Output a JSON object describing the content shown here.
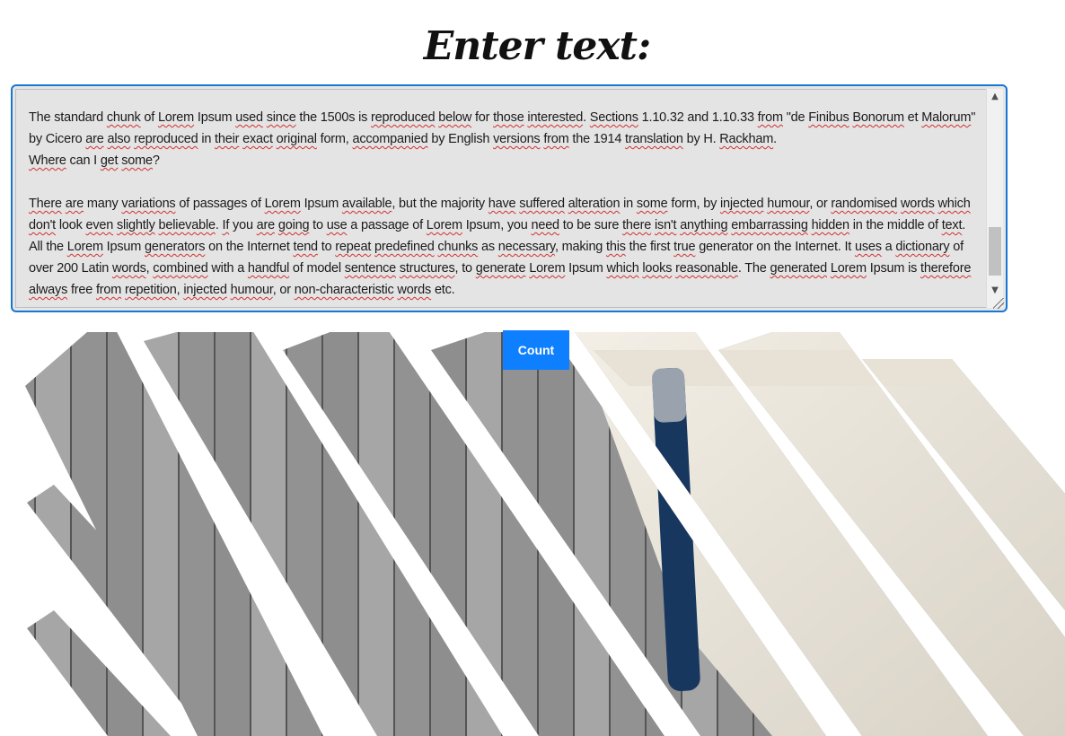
{
  "heading": "Enter text:",
  "textarea": {
    "segments": [
      [
        "The standard ",
        0
      ],
      [
        "chunk",
        1
      ],
      [
        " of ",
        0
      ],
      [
        "Lorem",
        1
      ],
      [
        " Ipsum ",
        0
      ],
      [
        "used",
        1
      ],
      [
        " ",
        0
      ],
      [
        "since",
        1
      ],
      [
        " the 1500s is ",
        0
      ],
      [
        "reproduced",
        1
      ],
      [
        " ",
        0
      ],
      [
        "below",
        1
      ],
      [
        " for ",
        0
      ],
      [
        "those",
        1
      ],
      [
        " ",
        0
      ],
      [
        "interested",
        1
      ],
      [
        ". ",
        0
      ],
      [
        "Sections",
        1
      ],
      [
        " 1.10.32 and 1.10.33 ",
        0
      ],
      [
        "from",
        1
      ],
      [
        " \"de ",
        0
      ],
      [
        "Finibus",
        1
      ],
      [
        " ",
        0
      ],
      [
        "Bonorum",
        1
      ],
      [
        " et ",
        0
      ],
      [
        "Malorum",
        1
      ],
      [
        "\" by Cicero ",
        0
      ],
      [
        "are",
        1
      ],
      [
        " ",
        0
      ],
      [
        "also",
        1
      ],
      [
        " ",
        0
      ],
      [
        "reproduced",
        1
      ],
      [
        " in ",
        0
      ],
      [
        "their",
        1
      ],
      [
        " ",
        0
      ],
      [
        "exact",
        1
      ],
      [
        " ",
        0
      ],
      [
        "original",
        1
      ],
      [
        " form, ",
        0
      ],
      [
        "accompanied",
        1
      ],
      [
        " by English ",
        0
      ],
      [
        "versions",
        1
      ],
      [
        " ",
        0
      ],
      [
        "from",
        1
      ],
      [
        " the 1914 ",
        0
      ],
      [
        "translation",
        1
      ],
      [
        " by H. ",
        0
      ],
      [
        "Rackham",
        1
      ],
      [
        ".\n",
        0
      ],
      [
        "Where",
        1
      ],
      [
        " can I ",
        0
      ],
      [
        "get",
        1
      ],
      [
        " ",
        0
      ],
      [
        "some",
        1
      ],
      [
        "?\n\n",
        0
      ],
      [
        "There",
        1
      ],
      [
        " ",
        0
      ],
      [
        "are",
        1
      ],
      [
        " many ",
        0
      ],
      [
        "variations",
        1
      ],
      [
        " of passages of ",
        0
      ],
      [
        "Lorem",
        1
      ],
      [
        " Ipsum ",
        0
      ],
      [
        "available",
        1
      ],
      [
        ", but the majority ",
        0
      ],
      [
        "have",
        1
      ],
      [
        " ",
        0
      ],
      [
        "suffered",
        1
      ],
      [
        " ",
        0
      ],
      [
        "alteration",
        1
      ],
      [
        " in ",
        0
      ],
      [
        "some",
        1
      ],
      [
        " form, by ",
        0
      ],
      [
        "injected",
        1
      ],
      [
        " ",
        0
      ],
      [
        "humour",
        1
      ],
      [
        ", or ",
        0
      ],
      [
        "randomised",
        1
      ],
      [
        " ",
        0
      ],
      [
        "words",
        1
      ],
      [
        " ",
        0
      ],
      [
        "which",
        1
      ],
      [
        " ",
        0
      ],
      [
        "don't",
        1
      ],
      [
        " look ",
        0
      ],
      [
        "even",
        1
      ],
      [
        " ",
        0
      ],
      [
        "slightly",
        1
      ],
      [
        " ",
        0
      ],
      [
        "believable",
        1
      ],
      [
        ". ",
        0
      ],
      [
        "If",
        1
      ],
      [
        " you ",
        0
      ],
      [
        "are",
        1
      ],
      [
        " ",
        0
      ],
      [
        "going",
        1
      ],
      [
        " to ",
        0
      ],
      [
        "use",
        1
      ],
      [
        " a passage of ",
        0
      ],
      [
        "Lorem",
        1
      ],
      [
        " Ipsum, you ",
        0
      ],
      [
        "need",
        1
      ],
      [
        " to be sure ",
        0
      ],
      [
        "there",
        1
      ],
      [
        " ",
        0
      ],
      [
        "isn't",
        1
      ],
      [
        " ",
        0
      ],
      [
        "anything",
        1
      ],
      [
        " ",
        0
      ],
      [
        "embarrassing",
        1
      ],
      [
        " ",
        0
      ],
      [
        "hidden",
        1
      ],
      [
        " in the middle of ",
        0
      ],
      [
        "text",
        1
      ],
      [
        ". All the ",
        0
      ],
      [
        "Lorem",
        1
      ],
      [
        " Ipsum ",
        0
      ],
      [
        "generators",
        1
      ],
      [
        " on the Internet ",
        0
      ],
      [
        "tend",
        1
      ],
      [
        " to ",
        0
      ],
      [
        "repeat",
        1
      ],
      [
        " ",
        0
      ],
      [
        "predefined",
        1
      ],
      [
        " ",
        0
      ],
      [
        "chunks",
        1
      ],
      [
        " as ",
        0
      ],
      [
        "necessary",
        1
      ],
      [
        ", making ",
        0
      ],
      [
        "this",
        1
      ],
      [
        " the first ",
        0
      ],
      [
        "true",
        1
      ],
      [
        " generator on the Internet. It ",
        0
      ],
      [
        "uses",
        1
      ],
      [
        " a ",
        0
      ],
      [
        "dictionary",
        1
      ],
      [
        " of over 200 Latin ",
        0
      ],
      [
        "words",
        1
      ],
      [
        ", ",
        0
      ],
      [
        "combined",
        1
      ],
      [
        " with a ",
        0
      ],
      [
        "handful",
        1
      ],
      [
        " of model ",
        0
      ],
      [
        "sentence",
        1
      ],
      [
        " ",
        0
      ],
      [
        "structures",
        1
      ],
      [
        ", to ",
        0
      ],
      [
        "generate",
        1
      ],
      [
        " ",
        0
      ],
      [
        "Lorem",
        1
      ],
      [
        " Ipsum ",
        0
      ],
      [
        "which",
        1
      ],
      [
        " ",
        0
      ],
      [
        "looks",
        1
      ],
      [
        " ",
        0
      ],
      [
        "reasonable",
        1
      ],
      [
        ". The ",
        0
      ],
      [
        "generated",
        1
      ],
      [
        " ",
        0
      ],
      [
        "Lorem",
        1
      ],
      [
        " Ipsum is ",
        0
      ],
      [
        "therefore",
        1
      ],
      [
        " ",
        0
      ],
      [
        "always",
        1
      ],
      [
        " free ",
        0
      ],
      [
        "from",
        1
      ],
      [
        " ",
        0
      ],
      [
        "repetition",
        1
      ],
      [
        ", ",
        0
      ],
      [
        "injected",
        1
      ],
      [
        " ",
        0
      ],
      [
        "humour",
        1
      ],
      [
        ", or ",
        0
      ],
      [
        "non-characteristic",
        1
      ],
      [
        " ",
        0
      ],
      [
        "words",
        1
      ],
      [
        " etc.",
        0
      ]
    ]
  },
  "count_button": {
    "label": "Count"
  },
  "colors": {
    "accent": "#0d7fff",
    "border": "#1976d2",
    "spellcheck": "#d32f2f"
  },
  "icons": {
    "scroll_up": "chevron-up-icon",
    "scroll_down": "chevron-down-icon",
    "resize": "resize-grip-icon"
  }
}
